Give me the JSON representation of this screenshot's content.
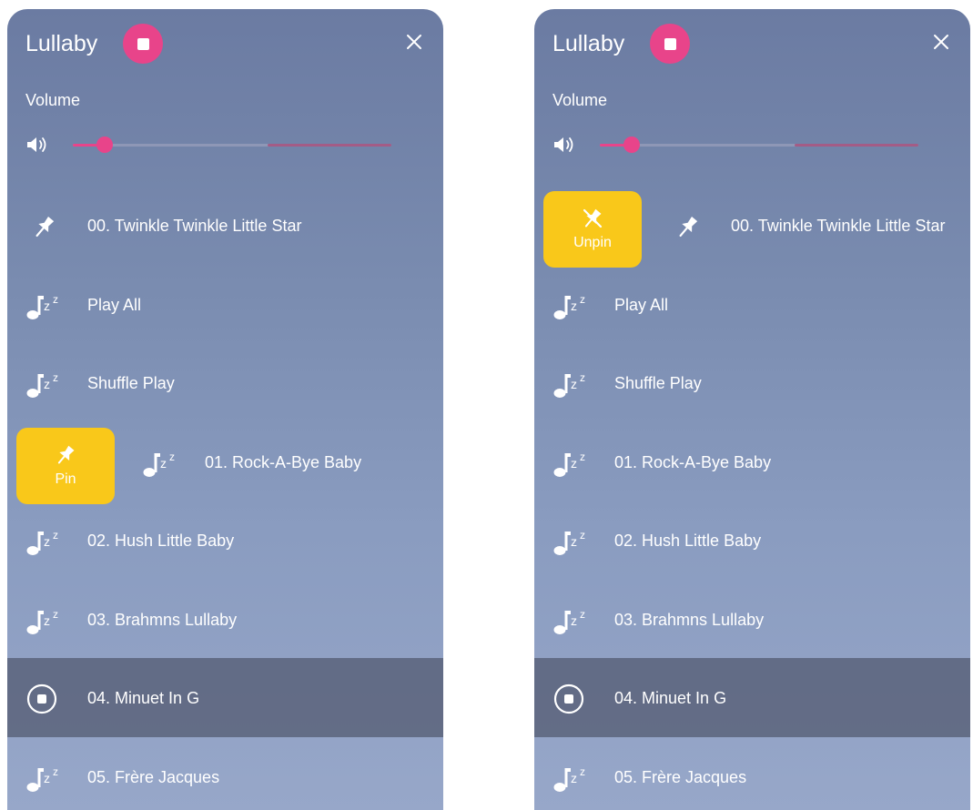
{
  "screens": [
    {
      "title": "Lullaby",
      "volume_label": "Volume",
      "volume_level": 0.1,
      "buffer_start": 0.61,
      "swipe_action": {
        "label": "Pin",
        "row_index": 3
      },
      "items": [
        {
          "label": "00. Twinkle Twinkle Little Star",
          "icon": "pin-icon"
        },
        {
          "label": "Play All",
          "icon": "music-sleep-icon"
        },
        {
          "label": "Shuffle Play",
          "icon": "music-sleep-icon"
        },
        {
          "label": "01. Rock-A-Bye Baby",
          "icon": "music-sleep-icon"
        },
        {
          "label": "02. Hush Little Baby",
          "icon": "music-sleep-icon"
        },
        {
          "label": "03. Brahmns Lullaby",
          "icon": "music-sleep-icon"
        },
        {
          "label": "04. Minuet In G",
          "icon": "stop-circle-icon",
          "active": true
        },
        {
          "label": "05. Frère Jacques",
          "icon": "music-sleep-icon"
        }
      ]
    },
    {
      "title": "Lullaby",
      "volume_label": "Volume",
      "volume_level": 0.1,
      "buffer_start": 0.61,
      "swipe_action": {
        "label": "Unpin",
        "row_index": 0
      },
      "items": [
        {
          "label": "00. Twinkle Twinkle Little Star",
          "icon": "pin-icon"
        },
        {
          "label": "Play All",
          "icon": "music-sleep-icon"
        },
        {
          "label": "Shuffle Play",
          "icon": "music-sleep-icon"
        },
        {
          "label": "01. Rock-A-Bye Baby",
          "icon": "music-sleep-icon"
        },
        {
          "label": "02. Hush Little Baby",
          "icon": "music-sleep-icon"
        },
        {
          "label": "03. Brahmns Lullaby",
          "icon": "music-sleep-icon"
        },
        {
          "label": "04. Minuet In G",
          "icon": "stop-circle-icon",
          "active": true
        },
        {
          "label": "05. Frère Jacques",
          "icon": "music-sleep-icon"
        }
      ]
    }
  ],
  "colors": {
    "accent_pink": "#e8448a",
    "swipe_yellow": "#f9c81a",
    "active_row": "#5a6278"
  }
}
